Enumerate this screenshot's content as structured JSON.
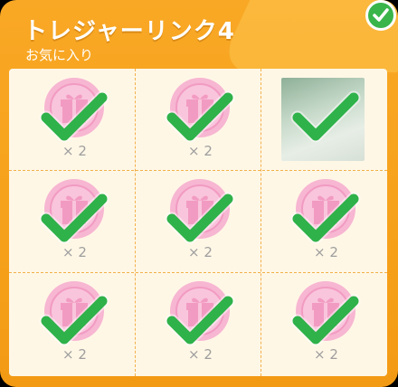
{
  "header": {
    "title": "トレジャーリンク4",
    "subtitle": "お気に入り"
  },
  "colors": {
    "panel": "#f7a21b",
    "grid_bg": "#fff7e6",
    "check": "#2fb24a",
    "coin": "#f7b6d2"
  },
  "icons": {
    "completed_badge": "check-circle-icon",
    "reward": "gift-coin-icon",
    "claimed": "check-mark-icon"
  },
  "rewards": [
    {
      "type": "gift-coin",
      "count": "× 2",
      "claimed": true
    },
    {
      "type": "gift-coin",
      "count": "× 2",
      "claimed": true
    },
    {
      "type": "image",
      "count": "",
      "claimed": true
    },
    {
      "type": "gift-coin",
      "count": "× 2",
      "claimed": true
    },
    {
      "type": "gift-coin",
      "count": "× 2",
      "claimed": true
    },
    {
      "type": "gift-coin",
      "count": "× 2",
      "claimed": true
    },
    {
      "type": "gift-coin",
      "count": "× 2",
      "claimed": true
    },
    {
      "type": "gift-coin",
      "count": "× 2",
      "claimed": true
    },
    {
      "type": "gift-coin",
      "count": "× 2",
      "claimed": true
    }
  ]
}
